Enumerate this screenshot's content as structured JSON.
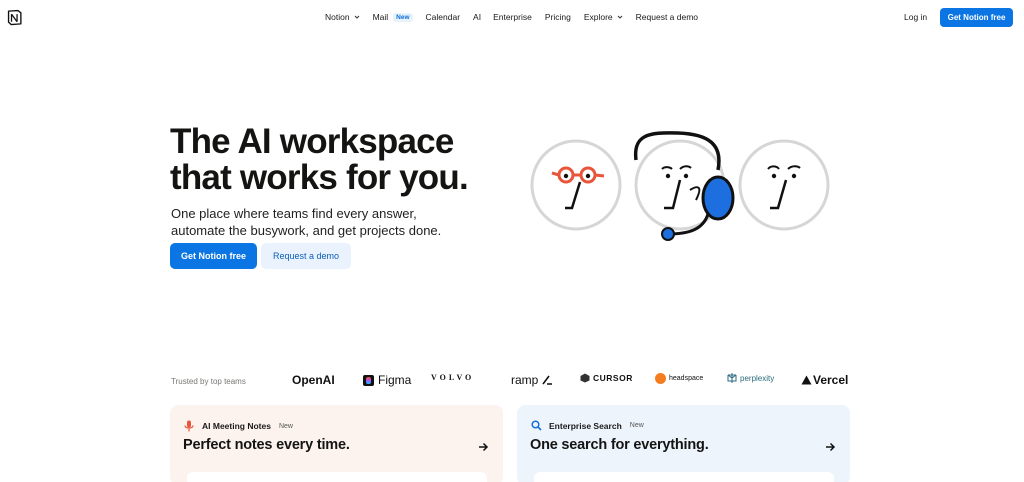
{
  "nav": {
    "items": [
      {
        "label": "Notion",
        "dropdown": true
      },
      {
        "label": "Mail",
        "badge": "New"
      },
      {
        "label": "Calendar"
      },
      {
        "label": "AI"
      },
      {
        "label": "Enterprise"
      },
      {
        "label": "Pricing"
      },
      {
        "label": "Explore",
        "dropdown": true
      },
      {
        "label": "Request a demo"
      }
    ],
    "login": "Log in",
    "cta": "Get Notion free"
  },
  "hero": {
    "title_line1": "The AI workspace",
    "title_line2": "that works for you.",
    "subtitle_line1": "One place where teams find every answer,",
    "subtitle_line2": "automate the busywork, and get projects done.",
    "primary_cta": "Get Notion free",
    "secondary_cta": "Request a demo"
  },
  "trusted": {
    "label": "Trusted by top teams",
    "logos": [
      "OpenAI",
      "Figma",
      "VOLVO",
      "ramp",
      "CURSOR",
      "headspace",
      "perplexity",
      "Vercel"
    ]
  },
  "cards": [
    {
      "tag": "AI Meeting Notes",
      "badge": "New",
      "title": "Perfect notes every time.",
      "icon": "microphone-icon"
    },
    {
      "tag": "Enterprise Search",
      "badge": "New",
      "title": "One search for everything.",
      "icon": "search-icon"
    }
  ],
  "colors": {
    "accent": "#0a75e3",
    "accent_light": "#eaf3fd",
    "card_warm": "#fcf3ee",
    "card_cool": "#eef4fc",
    "glasses": "#e8553b"
  }
}
